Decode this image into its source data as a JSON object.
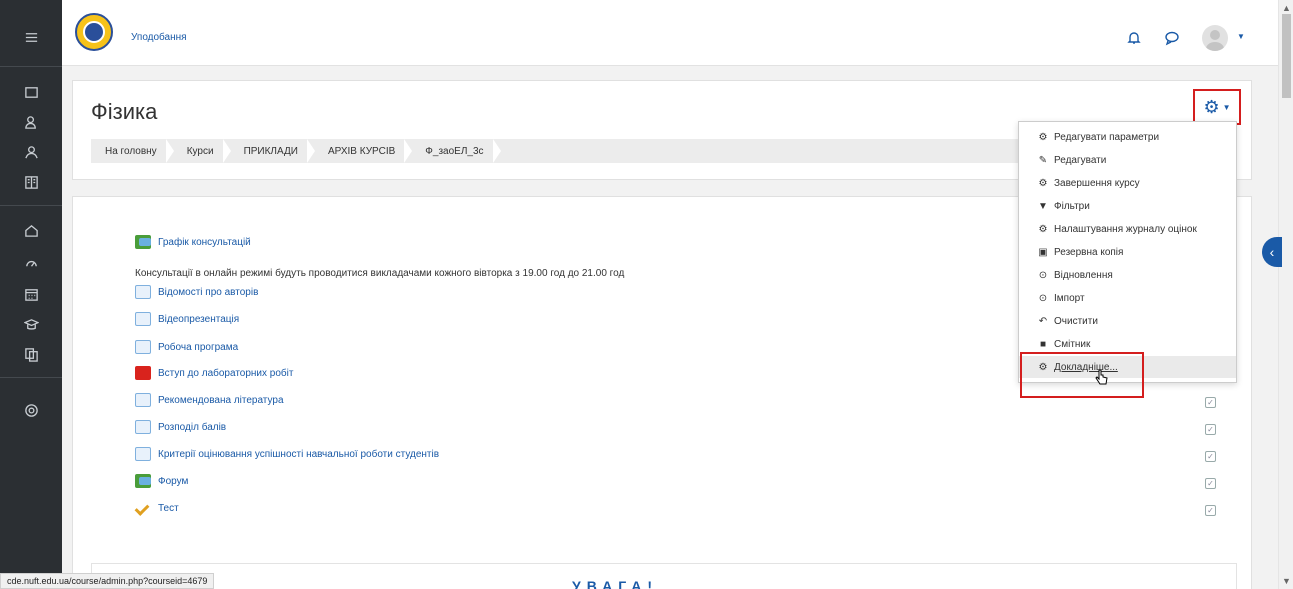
{
  "topbar": {
    "site_name": "Уподобання",
    "icons": [
      "bell-icon",
      "chat-icon",
      "user-avatar",
      "chevron-down-icon"
    ]
  },
  "sidebar": {
    "icons": [
      "menu-icon",
      "folder-icon",
      "users-icon",
      "users-group-icon",
      "book-icon",
      "home-icon",
      "dashboard-icon",
      "calendar-icon",
      "graduation-cap-icon",
      "files-icon",
      "gear-icon"
    ]
  },
  "header": {
    "title": "Фізика",
    "breadcrumb": [
      "На головну",
      "Курси",
      "ПРИКЛАДИ",
      "АРХІВ КУРСІВ",
      "Ф_заоЕЛ_3с"
    ]
  },
  "course": {
    "note": "Консультації в онлайн режимі будуть проводитися викладачами кожного вівторка з 19.00 год до 21.00 год",
    "activities": [
      {
        "label": "Графік консультацій",
        "type": "forum"
      },
      {
        "label": "Відомості про авторів",
        "type": "page"
      },
      {
        "label": "Відеопрезентація",
        "type": "page"
      },
      {
        "label": "Робоча програма",
        "type": "page"
      },
      {
        "label": "Вступ до лабораторних робіт",
        "type": "pdf"
      },
      {
        "label": "Рекомендована література",
        "type": "page"
      },
      {
        "label": "Розподіл балів",
        "type": "page"
      },
      {
        "label": "Критерії оцінювання успішності навчальної роботи студентів",
        "type": "page"
      },
      {
        "label": "Форум",
        "type": "forum"
      },
      {
        "label": "Тест",
        "type": "quiz"
      }
    ],
    "bottom_heading": "УВАГА!"
  },
  "menu": {
    "items": [
      {
        "label": "Редагувати параметри",
        "icon": "gear-icon"
      },
      {
        "label": "Редагувати",
        "icon": "pencil-icon"
      },
      {
        "label": "Завершення курсу",
        "icon": "gear-icon"
      },
      {
        "label": "Фільтри",
        "icon": "filter-icon"
      },
      {
        "label": "Налаштування журналу оцінок",
        "icon": "gear-icon"
      },
      {
        "label": "Резервна копія",
        "icon": "backup-icon"
      },
      {
        "label": "Відновлення",
        "icon": "restore-icon"
      },
      {
        "label": "Імпорт",
        "icon": "import-icon"
      },
      {
        "label": "Очистити",
        "icon": "reset-icon"
      },
      {
        "label": "Смітник",
        "icon": "trash-icon"
      },
      {
        "label": "Докладніше...",
        "icon": "gear-icon"
      }
    ]
  },
  "status_bar": {
    "url": "cde.nuft.edu.ua/course/admin.php?courseid=4679"
  },
  "colors": {
    "accent": "#1a5aa7",
    "sidebar": "#2b2f33",
    "highlight": "#d41e1e"
  }
}
